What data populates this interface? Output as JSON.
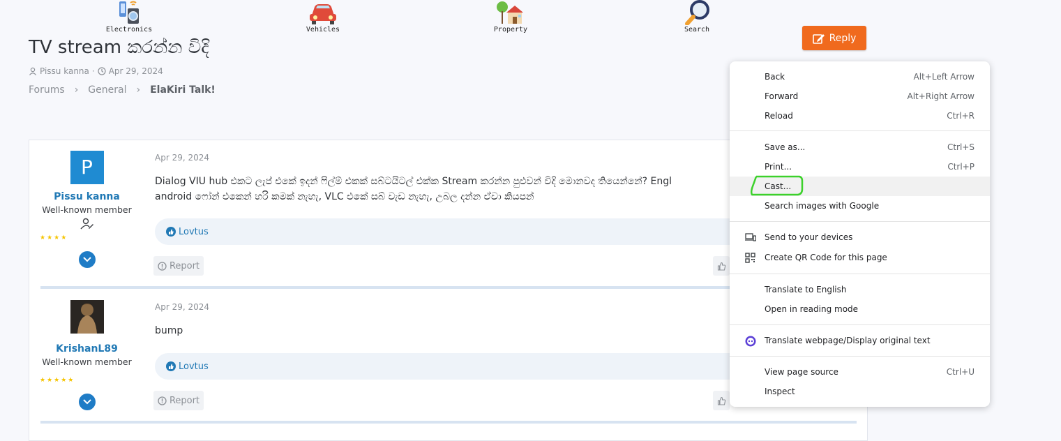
{
  "categories": [
    "Electronics",
    "Vehicles",
    "Property",
    "Search"
  ],
  "reply_label": "Reply",
  "thread": {
    "title": "TV stream කරන්න විදි",
    "author": "Pissu kanna",
    "date": "Apr 29, 2024"
  },
  "breadcrumbs": [
    "Forums",
    "General",
    "ElaKiri Talk!"
  ],
  "posts": [
    {
      "avatar_letter": "P",
      "username": "Pissu kanna",
      "role": "Well-known member",
      "stars": "★★★★",
      "date": "Apr 29, 2024",
      "body_line1": "Dialog VIU hub එකට ලැප් එකේ ඉදන් ෆිල්ම් එකක් සබ්ටයිටල් එක්ක Stream කරන්න පුළුවන් විදි මොනවද තියෙන්නේ? Engl",
      "body_line2": "android ෆෝන් එකෙන් හරි කමක් නැහැ, VLC එකේ සබ් වැඩ නැහැ, උබල දන්න ඒවා කියපන්",
      "reaction": "Lovtus",
      "report": "Report"
    },
    {
      "username": "KrishanL89",
      "role": "Well-known member",
      "stars": "★★★★★",
      "date": "Apr 29, 2024",
      "body_line1": "bump",
      "reaction": "Lovtus",
      "report": "Report"
    }
  ],
  "context_menu": {
    "back": {
      "label": "Back",
      "shortcut": "Alt+Left Arrow"
    },
    "forward": {
      "label": "Forward",
      "shortcut": "Alt+Right Arrow"
    },
    "reload": {
      "label": "Reload",
      "shortcut": "Ctrl+R"
    },
    "save_as": {
      "label": "Save as...",
      "shortcut": "Ctrl+S"
    },
    "print": {
      "label": "Print...",
      "shortcut": "Ctrl+P"
    },
    "cast": {
      "label": "Cast..."
    },
    "search_images": {
      "label": "Search images with Google"
    },
    "send_devices": {
      "label": "Send to your devices"
    },
    "qr_code": {
      "label": "Create QR Code for this page"
    },
    "translate": {
      "label": "Translate to English"
    },
    "reading_mode": {
      "label": "Open in reading mode"
    },
    "translate_ext": {
      "label": "Translate webpage/Display original text"
    },
    "view_source": {
      "label": "View page source",
      "shortcut": "Ctrl+U"
    },
    "inspect": {
      "label": "Inspect"
    }
  },
  "colors": {
    "accent": "#f06a1d",
    "link": "#2179b5",
    "avatar": "#1f8bd2",
    "highlight_ring": "#3cd12b"
  }
}
